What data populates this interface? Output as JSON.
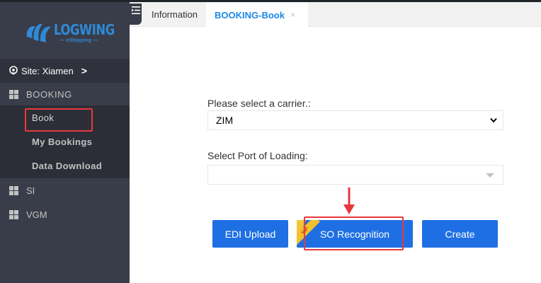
{
  "sidebar": {
    "logo_text": "LOGWING",
    "logo_sub": "— eShipping —",
    "site_label": "Site: Xiamen",
    "site_chevron": ">",
    "booking_label": "BOOKING",
    "booking_items": [
      {
        "label": "Book"
      },
      {
        "label": "My Bookings"
      },
      {
        "label": "Data Download"
      }
    ],
    "si_label": "SI",
    "vgm_label": "VGM"
  },
  "tabs": {
    "information_label": "Information",
    "active_label": "BOOKING-Book",
    "close_glyph": "×"
  },
  "form": {
    "carrier_label": "Please select a carrier.:",
    "carrier_value": "ZIM",
    "port_label": "Select Port of Loading:",
    "port_value": ""
  },
  "buttons": {
    "edi_upload": "EDI Upload",
    "so_recognition": "SO Recognition",
    "create": "Create",
    "vip_badge": "VIP"
  },
  "colors": {
    "sidebar_bg": "#393d49",
    "submenu_bg": "#2b2e37",
    "accent_blue": "#1e6fe3",
    "tab_active_text": "#1e88e5",
    "highlight_red": "#e8383d",
    "vip_yellow": "#f2c02c"
  }
}
